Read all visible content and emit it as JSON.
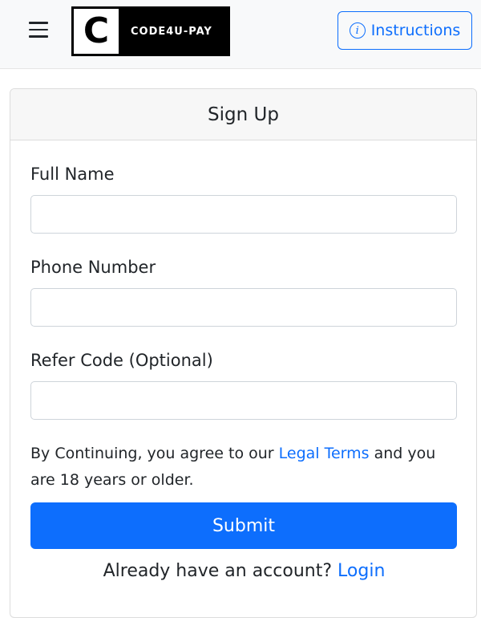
{
  "navbar": {
    "logo_letter": "C",
    "logo_text": "CODE4U-PAY",
    "instructions_icon": "i",
    "instructions_label": "Instructions"
  },
  "signup": {
    "title": "Sign Up",
    "fields": [
      {
        "label": "Full Name",
        "value": "",
        "placeholder": ""
      },
      {
        "label": "Phone Number",
        "value": "",
        "placeholder": ""
      },
      {
        "label": "Refer Code (Optional)",
        "value": "",
        "placeholder": ""
      }
    ],
    "terms_prefix": "By Continuing, you agree to our ",
    "terms_link": "Legal Terms",
    "terms_suffix": " and you are 18 years or older.",
    "submit_label": "Submit",
    "login_prompt": "Already have an account? ",
    "login_link": "Login"
  },
  "colors": {
    "primary": "#0d6efd",
    "navbar_bg": "#f8f9fa",
    "card_header_bg": "#f7f7f7",
    "text": "#212529"
  }
}
